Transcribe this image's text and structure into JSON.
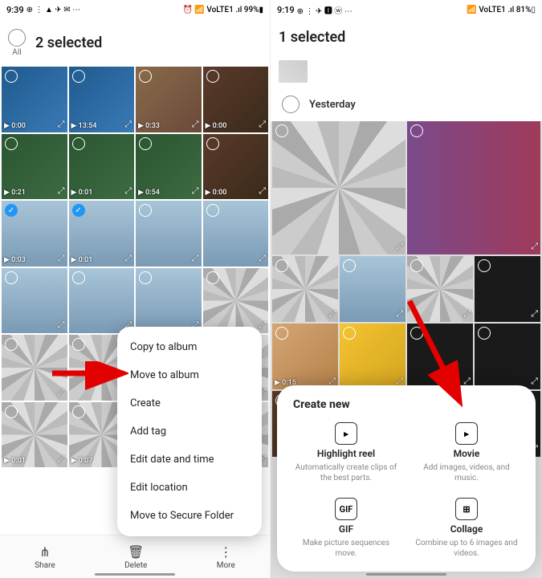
{
  "left": {
    "status": {
      "time": "9:39",
      "icons": "⊕ ⋮ ▲ ✈ ✉ ⋯",
      "right": "⏰ 📶 VoLTE1 .ıl 99%▮"
    },
    "all_label": "All",
    "title": "2 selected",
    "cells": [
      {
        "dur": "0:00",
        "cls": "c-blue"
      },
      {
        "dur": "13:54",
        "cls": "c-blue"
      },
      {
        "dur": "0:33",
        "cls": "c-room"
      },
      {
        "dur": "0:00",
        "cls": "c-brown"
      },
      {
        "dur": "0:21",
        "cls": "c-green"
      },
      {
        "dur": "0:01",
        "cls": "c-green"
      },
      {
        "dur": "0:54",
        "cls": "c-green"
      },
      {
        "dur": "0:00",
        "cls": "c-brown"
      },
      {
        "dur": "0:03",
        "cls": "c-sky",
        "sel": true
      },
      {
        "dur": "0:01",
        "cls": "c-sky",
        "sel": true
      },
      {
        "dur": "",
        "cls": "c-sky"
      },
      {
        "dur": "",
        "cls": "c-sky"
      },
      {
        "dur": "",
        "cls": "c-sky"
      },
      {
        "dur": "",
        "cls": "c-sky"
      },
      {
        "dur": "",
        "cls": "c-sky"
      },
      {
        "dur": "",
        "cls": "c-pix"
      },
      {
        "dur": "",
        "cls": "c-pix"
      },
      {
        "dur": "",
        "cls": "c-pix"
      },
      {
        "dur": "",
        "cls": "c-pix"
      },
      {
        "dur": "",
        "cls": "c-pix"
      },
      {
        "dur": "0:01",
        "cls": "c-pix"
      },
      {
        "dur": "0:07",
        "cls": "c-pix"
      },
      {
        "dur": "",
        "cls": "c-pix"
      },
      {
        "dur": "",
        "cls": "c-pix"
      }
    ],
    "menu": [
      "Copy to album",
      "Move to album",
      "Create",
      "Add tag",
      "Edit date and time",
      "Edit location",
      "Move to Secure Folder"
    ],
    "bottom": [
      {
        "icon": "⋔",
        "label": "Share"
      },
      {
        "icon": "🗑",
        "label": "Delete"
      },
      {
        "icon": "⋮",
        "label": "More"
      }
    ]
  },
  "right": {
    "status": {
      "time": "9:19",
      "icons": "⊕ ⋮ ✈ 🅸 ⓦ ⋯",
      "right": "📶 VoLTE1 .ıl 81%▯"
    },
    "title": "1 selected",
    "section": "Yesterday",
    "cells": [
      {
        "cls": "c-pix",
        "wide": true
      },
      {
        "cls": "c-purple",
        "wide": true
      },
      {
        "cls": "c-pix"
      },
      {
        "cls": "c-sky"
      },
      {
        "cls": "c-pix"
      },
      {
        "cls": "c-dark"
      },
      {
        "dur": "0:15",
        "cls": "c-dolls"
      },
      {
        "cls": "c-mm"
      },
      {
        "cls": "c-dark"
      },
      {
        "cls": "c-dark"
      },
      {
        "cls": "c-brown"
      },
      {
        "cls": "c-dark"
      },
      {
        "cls": "c-dark"
      },
      {
        "cls": "c-dark"
      }
    ],
    "sheet": {
      "title": "Create new",
      "items": [
        {
          "icon": "▸",
          "name": "Highlight reel",
          "desc": "Automatically create clips of the best parts."
        },
        {
          "icon": "▸",
          "name": "Movie",
          "desc": "Add images, videos, and music."
        },
        {
          "icon": "GIF",
          "name": "GIF",
          "desc": "Make picture sequences move."
        },
        {
          "icon": "⊞",
          "name": "Collage",
          "desc": "Combine up to 6 images and videos."
        }
      ]
    }
  }
}
